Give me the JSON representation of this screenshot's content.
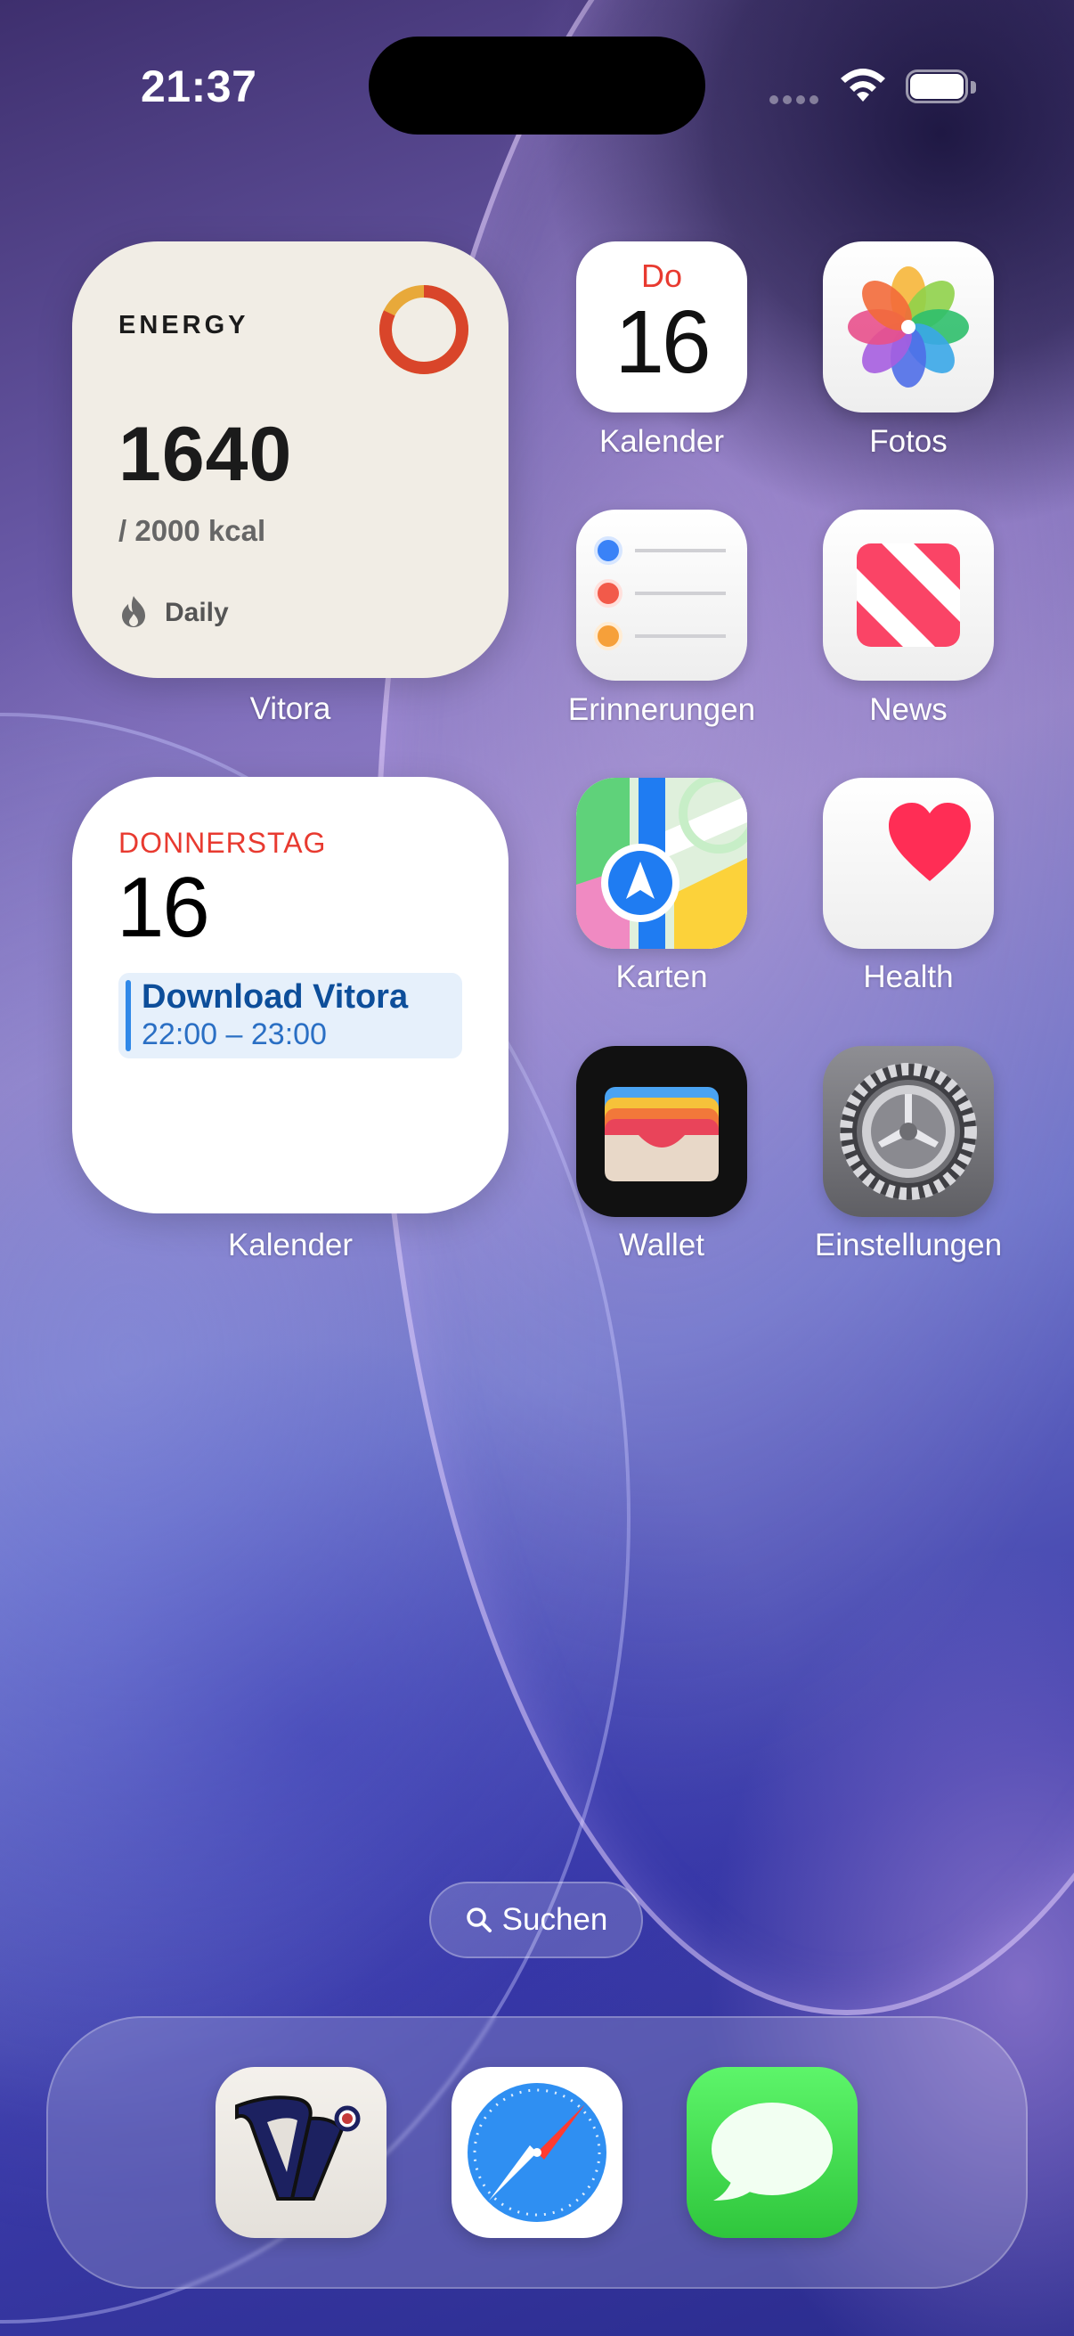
{
  "status_bar": {
    "time": "21:37"
  },
  "widgets": {
    "energy": {
      "title": "ENERGY",
      "value": "1640",
      "goal": "/ 2000 kcal",
      "period": "Daily",
      "progress": 0.82,
      "ring_colors": {
        "progress": "#d9452a",
        "remainder": "#e8a93a"
      },
      "caption": "Vitora"
    },
    "calendar": {
      "weekday": "DONNERSTAG",
      "day": "16",
      "event_title": "Download Vitora",
      "event_time": "22:00 – 23:00",
      "caption": "Kalender"
    }
  },
  "apps": [
    {
      "name": "Kalender",
      "icon": "calendar-icon",
      "month": "Do",
      "day": "16"
    },
    {
      "name": "Fotos",
      "icon": "photos-icon"
    },
    {
      "name": "Erinnerungen",
      "icon": "reminders-icon"
    },
    {
      "name": "News",
      "icon": "news-icon"
    },
    {
      "name": "Karten",
      "icon": "maps-icon"
    },
    {
      "name": "Health",
      "icon": "heart-icon"
    },
    {
      "name": "Wallet",
      "icon": "wallet-icon"
    },
    {
      "name": "Einstellungen",
      "icon": "gear-icon"
    }
  ],
  "search": {
    "label": "Suchen"
  },
  "dock": [
    {
      "name": "Vitora",
      "icon": "vitora-icon"
    },
    {
      "name": "Safari",
      "icon": "safari-icon"
    },
    {
      "name": "Nachrichten",
      "icon": "messages-icon"
    }
  ]
}
